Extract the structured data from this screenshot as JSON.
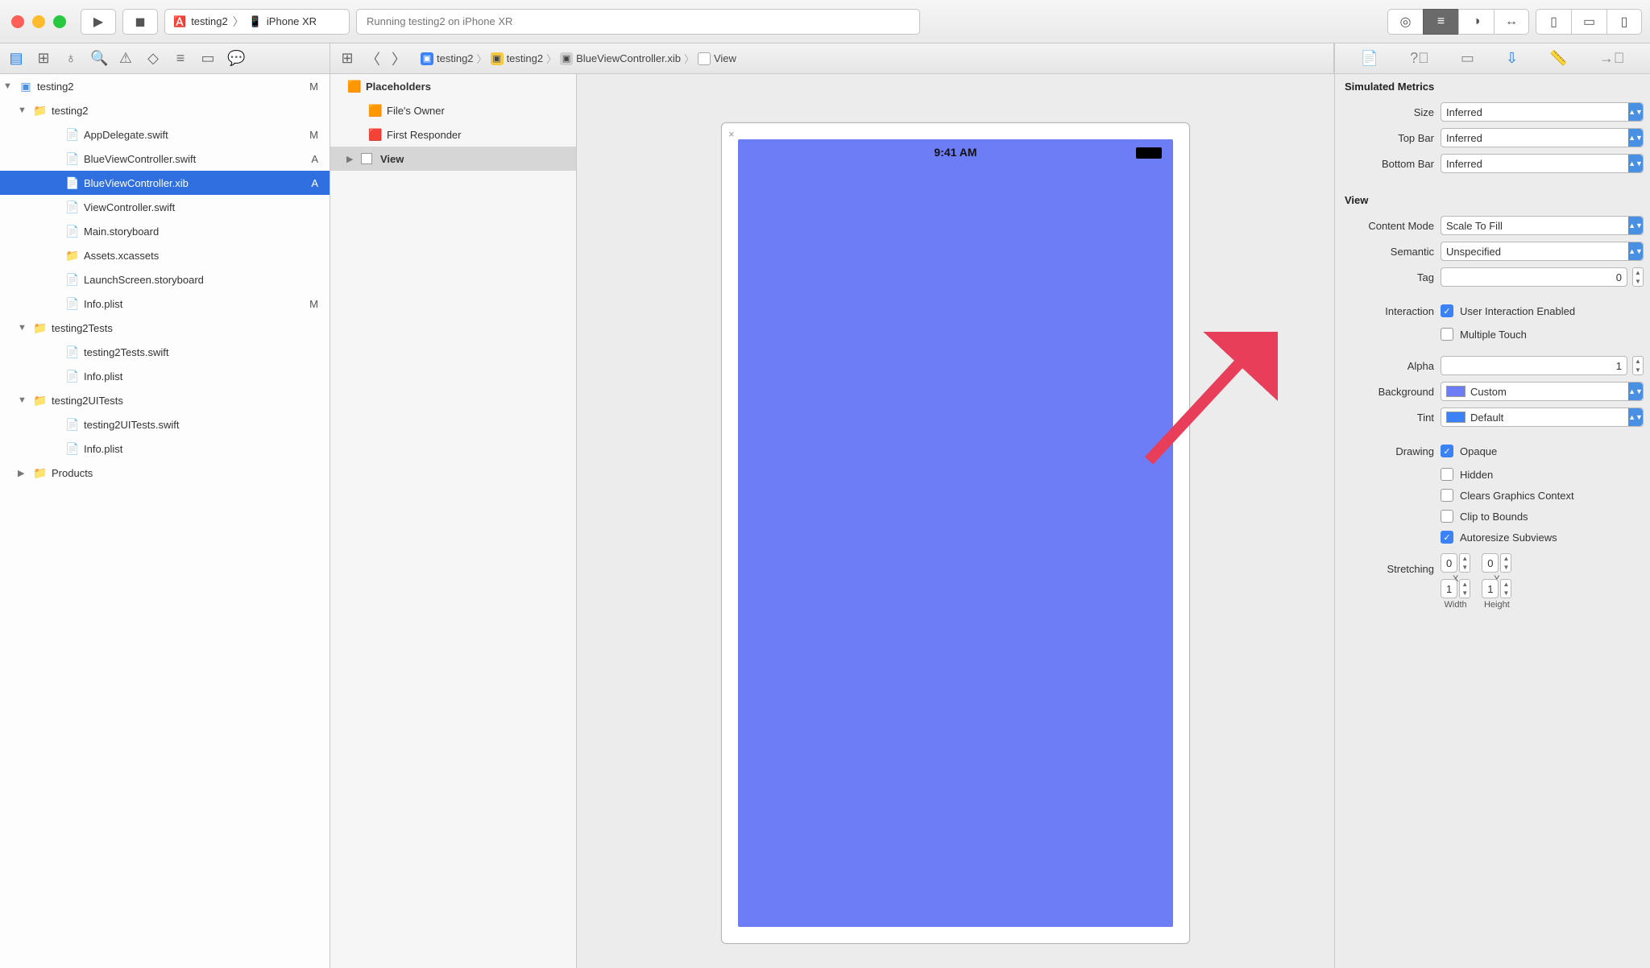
{
  "toolbar": {
    "scheme_target": "testing2",
    "scheme_device": "iPhone XR",
    "status_text": "Running testing2 on iPhone XR"
  },
  "crumbs": [
    "testing2",
    "testing2",
    "BlueViewController.xib",
    "View"
  ],
  "navigator": {
    "root": {
      "name": "testing2",
      "badge": "M"
    },
    "group1": {
      "name": "testing2"
    },
    "files1": [
      {
        "name": "AppDelegate.swift",
        "badge": "M"
      },
      {
        "name": "BlueViewController.swift",
        "badge": "A"
      },
      {
        "name": "BlueViewController.xib",
        "badge": "A",
        "selected": true
      },
      {
        "name": "ViewController.swift",
        "badge": ""
      },
      {
        "name": "Main.storyboard",
        "badge": ""
      },
      {
        "name": "Assets.xcassets",
        "badge": ""
      },
      {
        "name": "LaunchScreen.storyboard",
        "badge": ""
      },
      {
        "name": "Info.plist",
        "badge": "M"
      }
    ],
    "group2": {
      "name": "testing2Tests"
    },
    "files2": [
      {
        "name": "testing2Tests.swift"
      },
      {
        "name": "Info.plist"
      }
    ],
    "group3": {
      "name": "testing2UITests"
    },
    "files3": [
      {
        "name": "testing2UITests.swift"
      },
      {
        "name": "Info.plist"
      }
    ],
    "products": "Products"
  },
  "outline": {
    "placeholders_label": "Placeholders",
    "files_owner": "File's Owner",
    "first_responder": "First Responder",
    "view": "View"
  },
  "canvas": {
    "time": "9:41 AM"
  },
  "inspector": {
    "simulated_metrics_title": "Simulated Metrics",
    "size_label": "Size",
    "size_value": "Inferred",
    "topbar_label": "Top Bar",
    "topbar_value": "Inferred",
    "bottombar_label": "Bottom Bar",
    "bottombar_value": "Inferred",
    "view_title": "View",
    "contentmode_label": "Content Mode",
    "contentmode_value": "Scale To Fill",
    "semantic_label": "Semantic",
    "semantic_value": "Unspecified",
    "tag_label": "Tag",
    "tag_value": "0",
    "interaction_label": "Interaction",
    "user_interaction": "User Interaction Enabled",
    "multiple_touch": "Multiple Touch",
    "alpha_label": "Alpha",
    "alpha_value": "1",
    "background_label": "Background",
    "background_value": "Custom",
    "tint_label": "Tint",
    "tint_value": "Default",
    "drawing_label": "Drawing",
    "opaque": "Opaque",
    "hidden": "Hidden",
    "clears_context": "Clears Graphics Context",
    "clip_bounds": "Clip to Bounds",
    "autoresize": "Autoresize Subviews",
    "stretching_label": "Stretching",
    "x_value": "0",
    "y_value": "0",
    "x_label": "X",
    "y_label": "Y",
    "w_value": "1",
    "h_value": "1",
    "w_label": "Width",
    "h_label": "Height"
  }
}
